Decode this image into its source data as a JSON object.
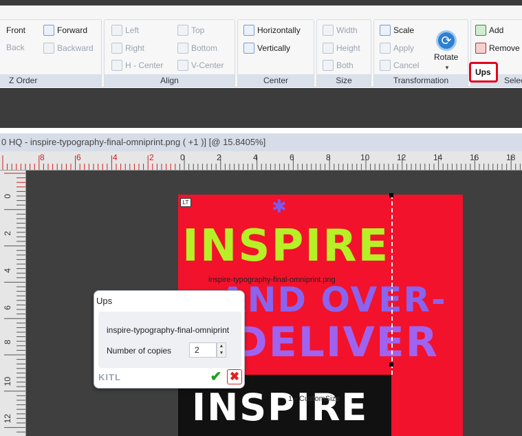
{
  "ribbon": {
    "zorder": {
      "front": "Front",
      "back": "Back",
      "forward": "Forward",
      "backward": "Backward",
      "group_label": "Z Order"
    },
    "align": {
      "left": "Left",
      "right": "Right",
      "h_center": "H - Center",
      "top": "Top",
      "bottom": "Bottom",
      "v_center": "V-Center",
      "group_label": "Align"
    },
    "center": {
      "horizontally": "Horizontally",
      "vertically": "Vertically",
      "group_label": "Center"
    },
    "size": {
      "width": "Width",
      "height": "Height",
      "both": "Both",
      "group_label": "Size"
    },
    "transformation": {
      "scale": "Scale",
      "apply": "Apply",
      "cancel": "Cancel",
      "rotate": "Rotate",
      "group_label": "Transformation"
    },
    "select": {
      "add": "Add",
      "remove": "Remove",
      "ups": "Ups",
      "group_label": "Selec"
    }
  },
  "document": {
    "tab_title": "0 HQ - inspire-typography-final-omniprint.png ( +1 )] [@ 15.8405%]"
  },
  "rulers": {
    "h_red": [
      "8",
      "6",
      "4",
      "2"
    ],
    "h_black": [
      "0",
      "2",
      "4",
      "6",
      "8",
      "10",
      "12",
      "14",
      "16",
      "18"
    ],
    "v": [
      "0",
      "2",
      "4",
      "6",
      "8",
      "10",
      "12"
    ]
  },
  "canvas": {
    "corner_tag": "LT",
    "poster_line1": "INSPIRE",
    "poster_line2": "AND OVER-",
    "poster_line3": "DELIVER",
    "poster_line4": "INSPIRE",
    "overlay_filename": "inspire-typography-final-omniprint.png",
    "custom_size_label": "1 - CustomSize"
  },
  "ups_dialog": {
    "title": "Ups",
    "filename": "inspire-typography-final-omniprint",
    "copies_label": "Number of copies",
    "copies_value": "2",
    "logo": "KITL"
  },
  "colors": {
    "poster_red": "#f2122b",
    "highlight_red": "#e2001a",
    "ok_green": "#1da11d"
  }
}
